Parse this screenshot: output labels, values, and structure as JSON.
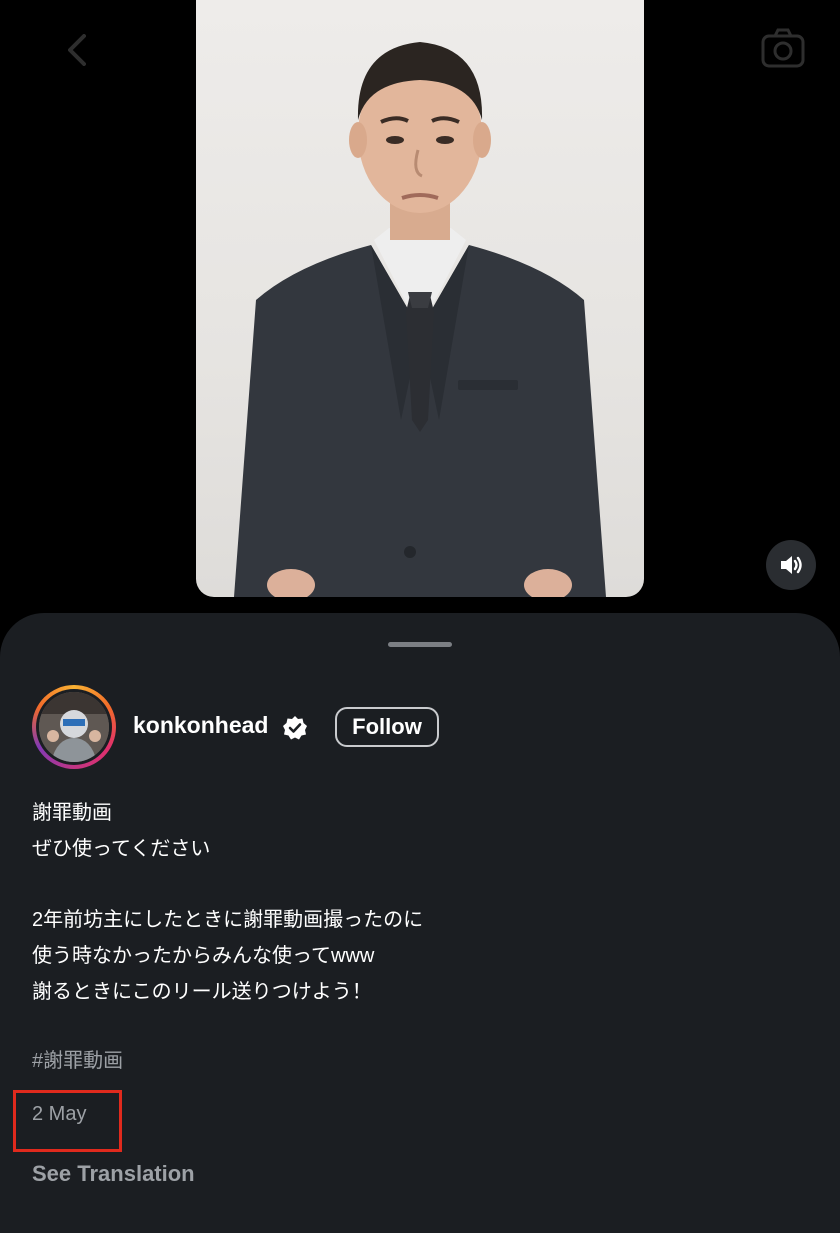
{
  "header": {
    "back_icon": "chevron-left-icon",
    "camera_icon": "camera-icon"
  },
  "video": {
    "sound_icon": "speaker-icon"
  },
  "post": {
    "username": "konkonhead",
    "verified": true,
    "follow_label": "Follow",
    "caption_lines": [
      "謝罪動画",
      "ぜひ使ってください",
      "2年前坊主にしたときに謝罪動画撮ったのに",
      "使う時なかったからみんな使ってwww",
      "謝るときにこのリール送りつけよう！"
    ],
    "hashtag": "#謝罪動画",
    "date": "2 May",
    "see_translation": "See Translation"
  },
  "colors": {
    "sheet": "#1b1e22",
    "highlight_box": "#e02a1d",
    "muted_text": "#9da1a6"
  }
}
